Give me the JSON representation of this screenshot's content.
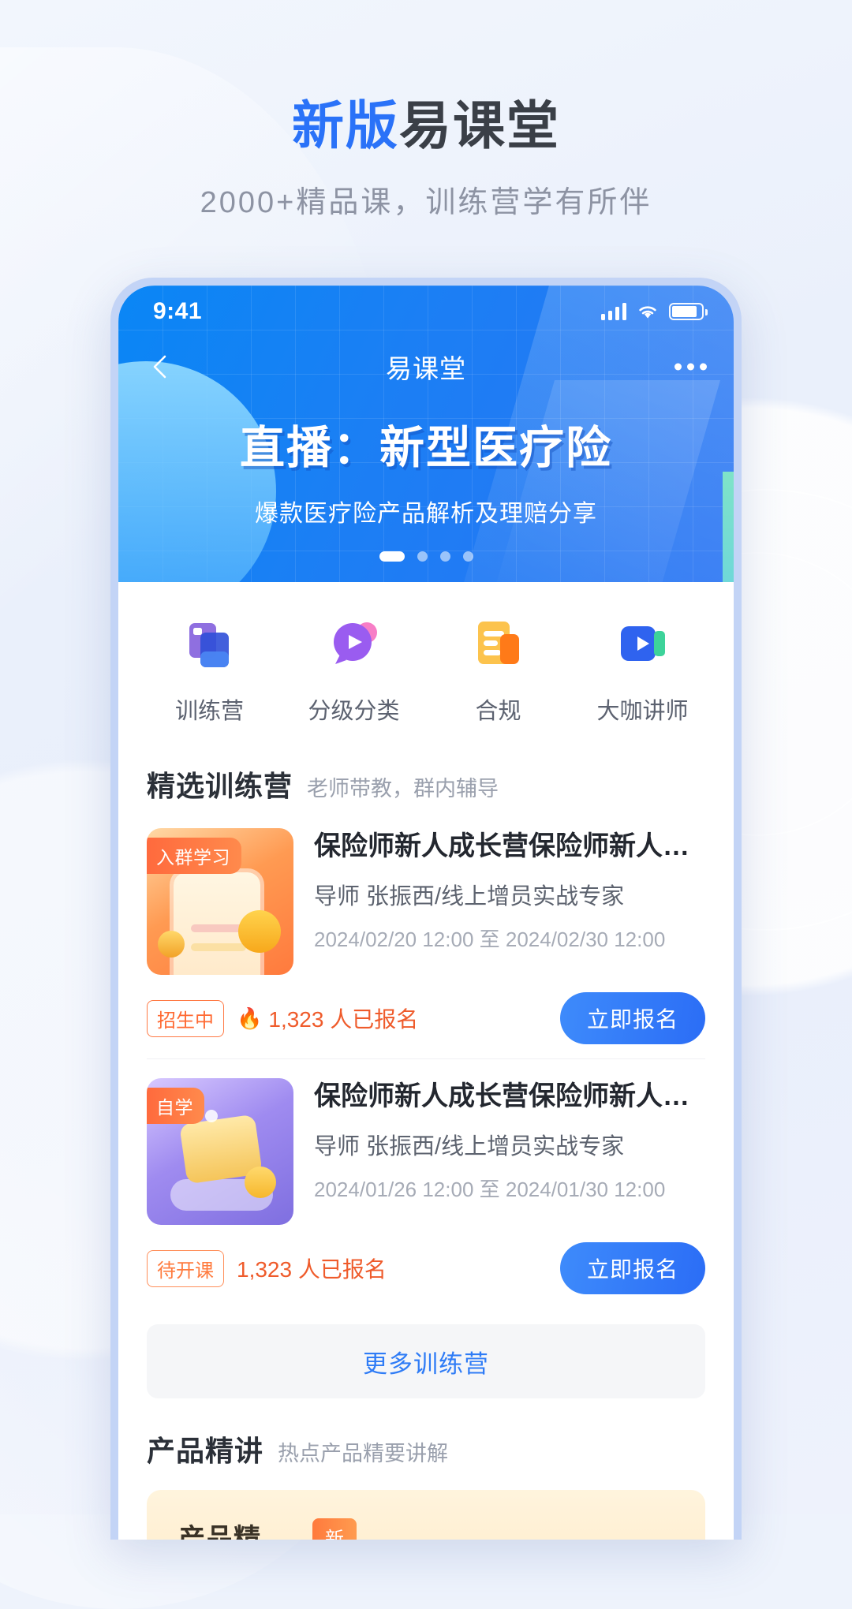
{
  "promo": {
    "headline_highlight": "新版",
    "headline_rest": "易课堂",
    "subtitle": "2000+精品课，训练营学有所伴",
    "accent_color": "#2a72f8",
    "dark_color": "#3a3f47"
  },
  "status_bar": {
    "time": "9:41"
  },
  "nav": {
    "title": "易课堂",
    "back_icon": "chevron-left-icon",
    "more_icon": "more-horizontal-icon"
  },
  "banner": {
    "title": "直播：新型医疗险",
    "subtitle": "爆款医疗险产品解析及理赔分享",
    "slide_count": 4,
    "active_slide": 1
  },
  "categories": [
    {
      "label": "训练营",
      "icon": "training-camp-icon"
    },
    {
      "label": "分级分类",
      "icon": "category-play-icon"
    },
    {
      "label": "合规",
      "icon": "compliance-doc-icon"
    },
    {
      "label": "大咖讲师",
      "icon": "expert-video-icon"
    }
  ],
  "featured_section": {
    "title": "精选训练营",
    "subtitle": "老师带教，群内辅导",
    "more_label": "更多训练营"
  },
  "courses": [
    {
      "badge": "入群学习",
      "title": "保险师新人成长营保险师新人…",
      "teacher": "导师 张振西/线上增员实战专家",
      "date_range": "2024/02/20 12:00 至 2024/02/30 12:00",
      "status_tag": "招生中",
      "enroll_count": "1,323 人已报名",
      "fire_icon": "fire-icon",
      "show_fire": true,
      "action_label": "立即报名"
    },
    {
      "badge": "自学",
      "title": "保险师新人成长营保险师新人…",
      "teacher": "导师 张振西/线上增员实战专家",
      "date_range": "2024/01/26 12:00 至 2024/01/30 12:00",
      "status_tag": "待开课",
      "enroll_count": "1,323 人已报名",
      "fire_icon": "fire-icon",
      "show_fire": false,
      "action_label": "立即报名"
    }
  ],
  "product_section": {
    "title": "产品精讲",
    "subtitle": "热点产品精要讲解",
    "card_title": "产品精",
    "card_pill": "新"
  }
}
